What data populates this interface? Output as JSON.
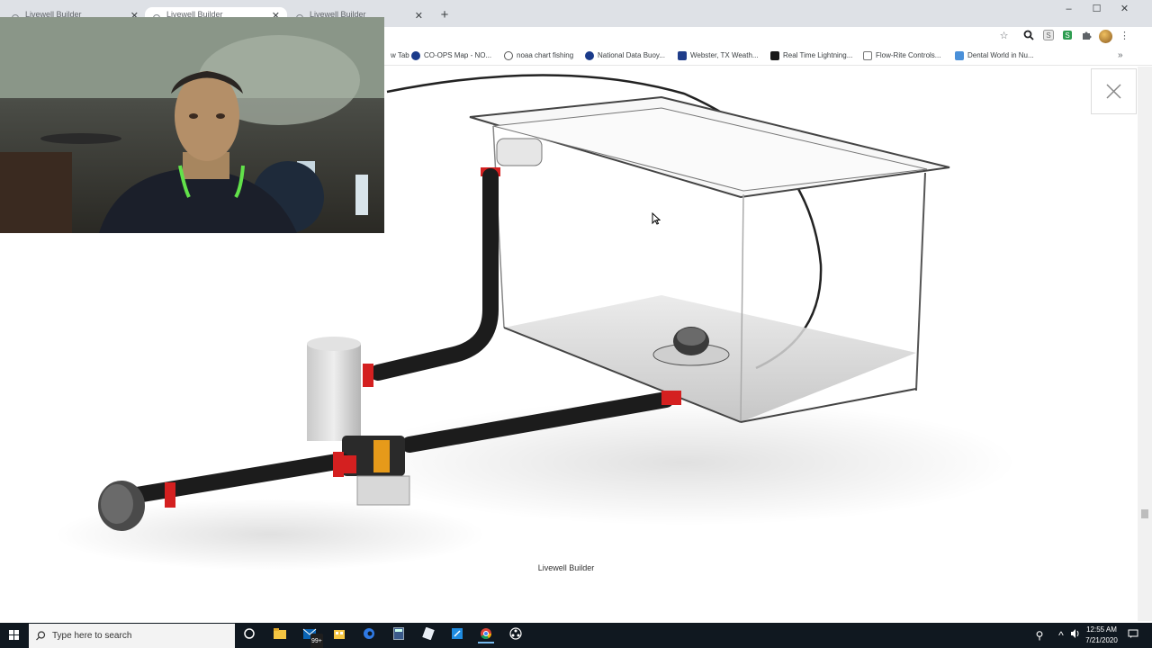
{
  "browser": {
    "tabs": [
      {
        "title": "Livewell Builder",
        "active": false
      },
      {
        "title": "Livewell Builder",
        "active": true
      },
      {
        "title": "Livewell Builder",
        "active": false
      }
    ],
    "new_tab_label": "+",
    "window_controls": {
      "minimize": "–",
      "maximize": "☐",
      "close": "✕"
    }
  },
  "bookmarks": [
    {
      "label": "w Tab",
      "icon_color": "#ffffff"
    },
    {
      "label": "CO-OPS Map - NO...",
      "icon_color": "#1a3a8a"
    },
    {
      "label": "noaa chart fishing",
      "icon_color": "#555555"
    },
    {
      "label": "National Data Buoy...",
      "icon_color": "#1a3a8a"
    },
    {
      "label": "Webster, TX Weath...",
      "icon_color": "#1f3d8a"
    },
    {
      "label": "Real Time Lightning...",
      "icon_color": "#1a1a1a"
    },
    {
      "label": "Flow-Rite Controls...",
      "icon_color": "#777777"
    },
    {
      "label": "Dental World in Nu...",
      "icon_color": "#4a90d9"
    }
  ],
  "bookmarks_more": "»",
  "viewer": {
    "caption": "Livewell Builder",
    "close_icon": "close-icon"
  },
  "taskbar": {
    "search_placeholder": "Type here to search",
    "mail_badge": "99+",
    "time": "12:55 AM",
    "date": "7/21/2020"
  },
  "colors": {
    "accent_red": "#d42020",
    "pipe_black": "#1c1c1c",
    "taskbar_bg": "#101820",
    "tabstrip_bg": "#dee1e6"
  }
}
